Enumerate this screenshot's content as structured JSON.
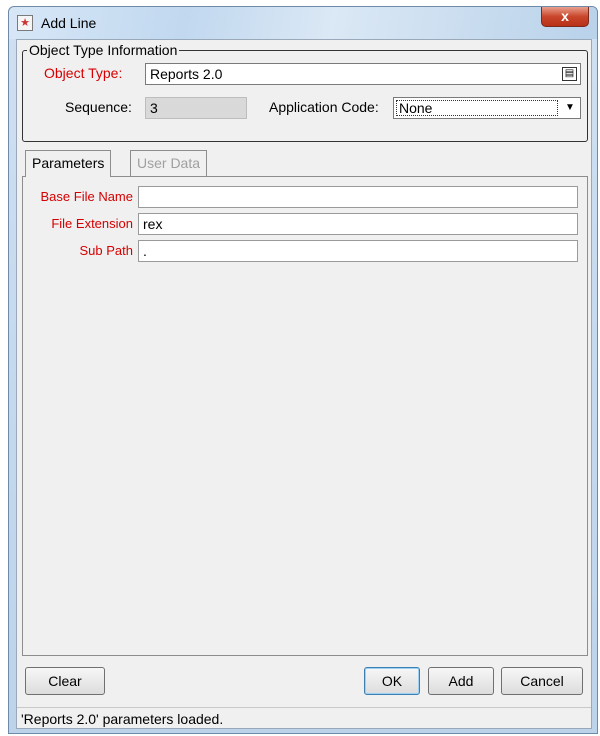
{
  "window": {
    "title": "Add Line",
    "close_glyph": "x"
  },
  "object_type_info": {
    "group_title": "Object Type Information",
    "object_type_label": "Object Type:",
    "object_type_value": "Reports 2.0",
    "sequence_label": "Sequence:",
    "sequence_value": "3",
    "application_code_label": "Application Code:",
    "application_code_value": "None"
  },
  "tabs": [
    {
      "label": "Parameters",
      "active": true,
      "enabled": true
    },
    {
      "label": "User Data",
      "active": false,
      "enabled": false
    }
  ],
  "parameters": {
    "base_file_name_label": "Base File Name",
    "base_file_name_value": "",
    "file_extension_label": "File Extension",
    "file_extension_value": "rex",
    "sub_path_label": "Sub Path",
    "sub_path_value": "."
  },
  "buttons": {
    "clear": "Clear",
    "ok": "OK",
    "add": "Add",
    "cancel": "Cancel"
  },
  "status": "'Reports 2.0' parameters loaded.",
  "icons": {
    "app": "java-app-icon",
    "lookup": "lookup-list-icon",
    "dropdown": "chevron-down-icon"
  },
  "colors": {
    "required_label": "#d60000",
    "close_button": "#c9462c"
  }
}
